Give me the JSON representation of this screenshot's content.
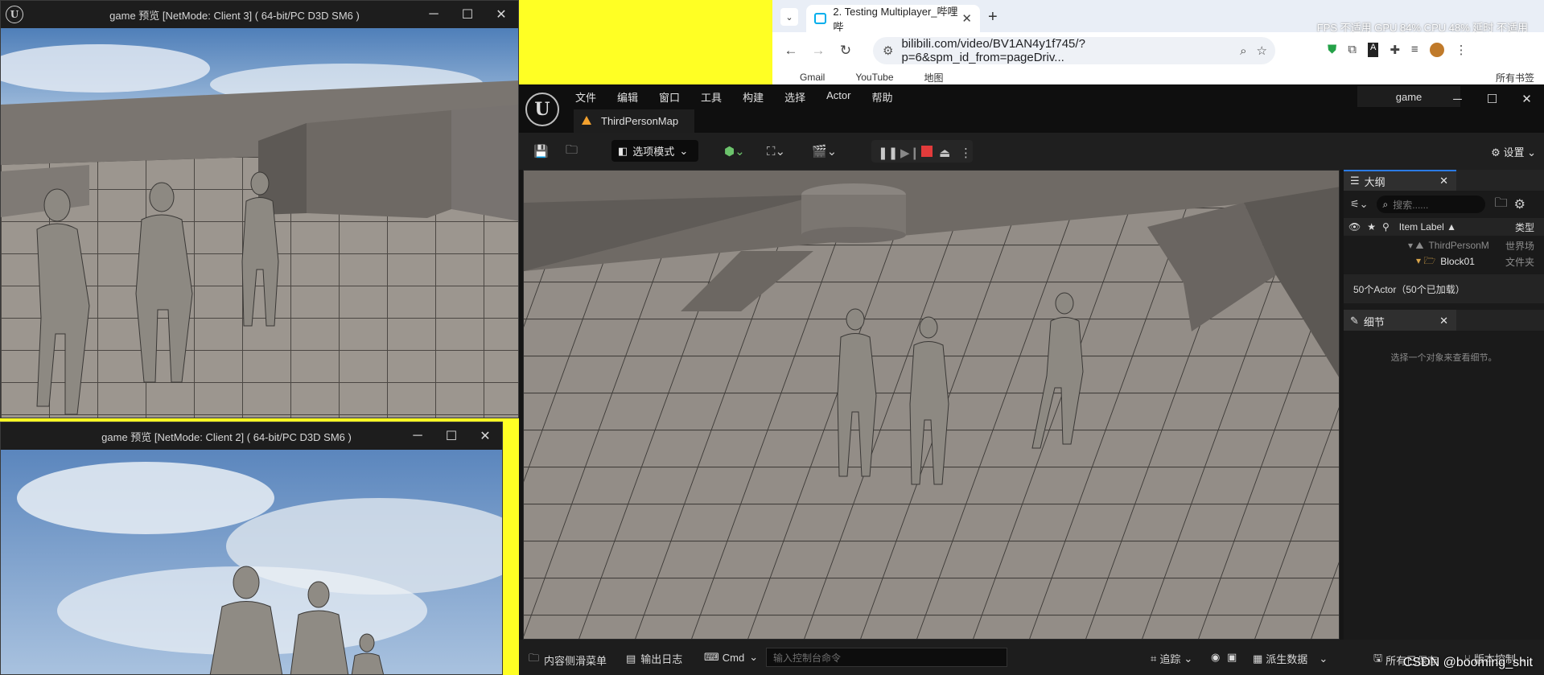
{
  "client3": {
    "title": "game 预览 [NetMode: Client 3]  ( 64-bit/PC D3D SM6 )",
    "minimize": "─",
    "maximize": "☐",
    "close": "✕"
  },
  "client2": {
    "title": "game 预览 [NetMode: Client 2]  ( 64-bit/PC D3D SM6 )",
    "minimize": "─",
    "maximize": "☐",
    "close": "✕"
  },
  "chrome": {
    "tab_title": "2. Testing Multiplayer_哔哩哔",
    "tab_close": "✕",
    "new_tab": "+",
    "url": "bilibili.com/video/BV1AN4y1f745/?p=6&spm_id_from=pageDriv...",
    "bookmarks": [
      "Gmail",
      "YouTube",
      "地图"
    ],
    "all_bookmarks": "所有书签",
    "fps_overlay": "FPS 不适用 GPU 84% CPU 48% 延时 不适用"
  },
  "editor": {
    "logo": "U",
    "menu": [
      "文件",
      "编辑",
      "窗口",
      "工具",
      "构建",
      "选择",
      "Actor",
      "帮助"
    ],
    "map_tab": "ThirdPersonMap",
    "project": "game",
    "select_mode": "选项模式",
    "settings": "设置",
    "outliner": {
      "title": "大纲",
      "search_placeholder": "搜索......",
      "col_label": "Item Label ▲",
      "col_type": "类型",
      "rows": [
        {
          "label": "ThirdPersonM",
          "type": "世界场"
        },
        {
          "label": "Block01",
          "type": "文件夹"
        }
      ],
      "actor_count": "50个Actor（50个已加载）"
    },
    "details": {
      "title": "细节",
      "empty_hint": "选择一个对象来查看细节。"
    },
    "bottom": {
      "content_drawer": "内容侧滑菜单",
      "output_log": "输出日志",
      "cmd": "Cmd",
      "console_placeholder": "输入控制台命令",
      "trace": "追踪",
      "derived_data": "派生数据",
      "all_saved": "所有已保存",
      "source_control": "版本控制"
    }
  },
  "watermark": "CSDN @booming_shit"
}
